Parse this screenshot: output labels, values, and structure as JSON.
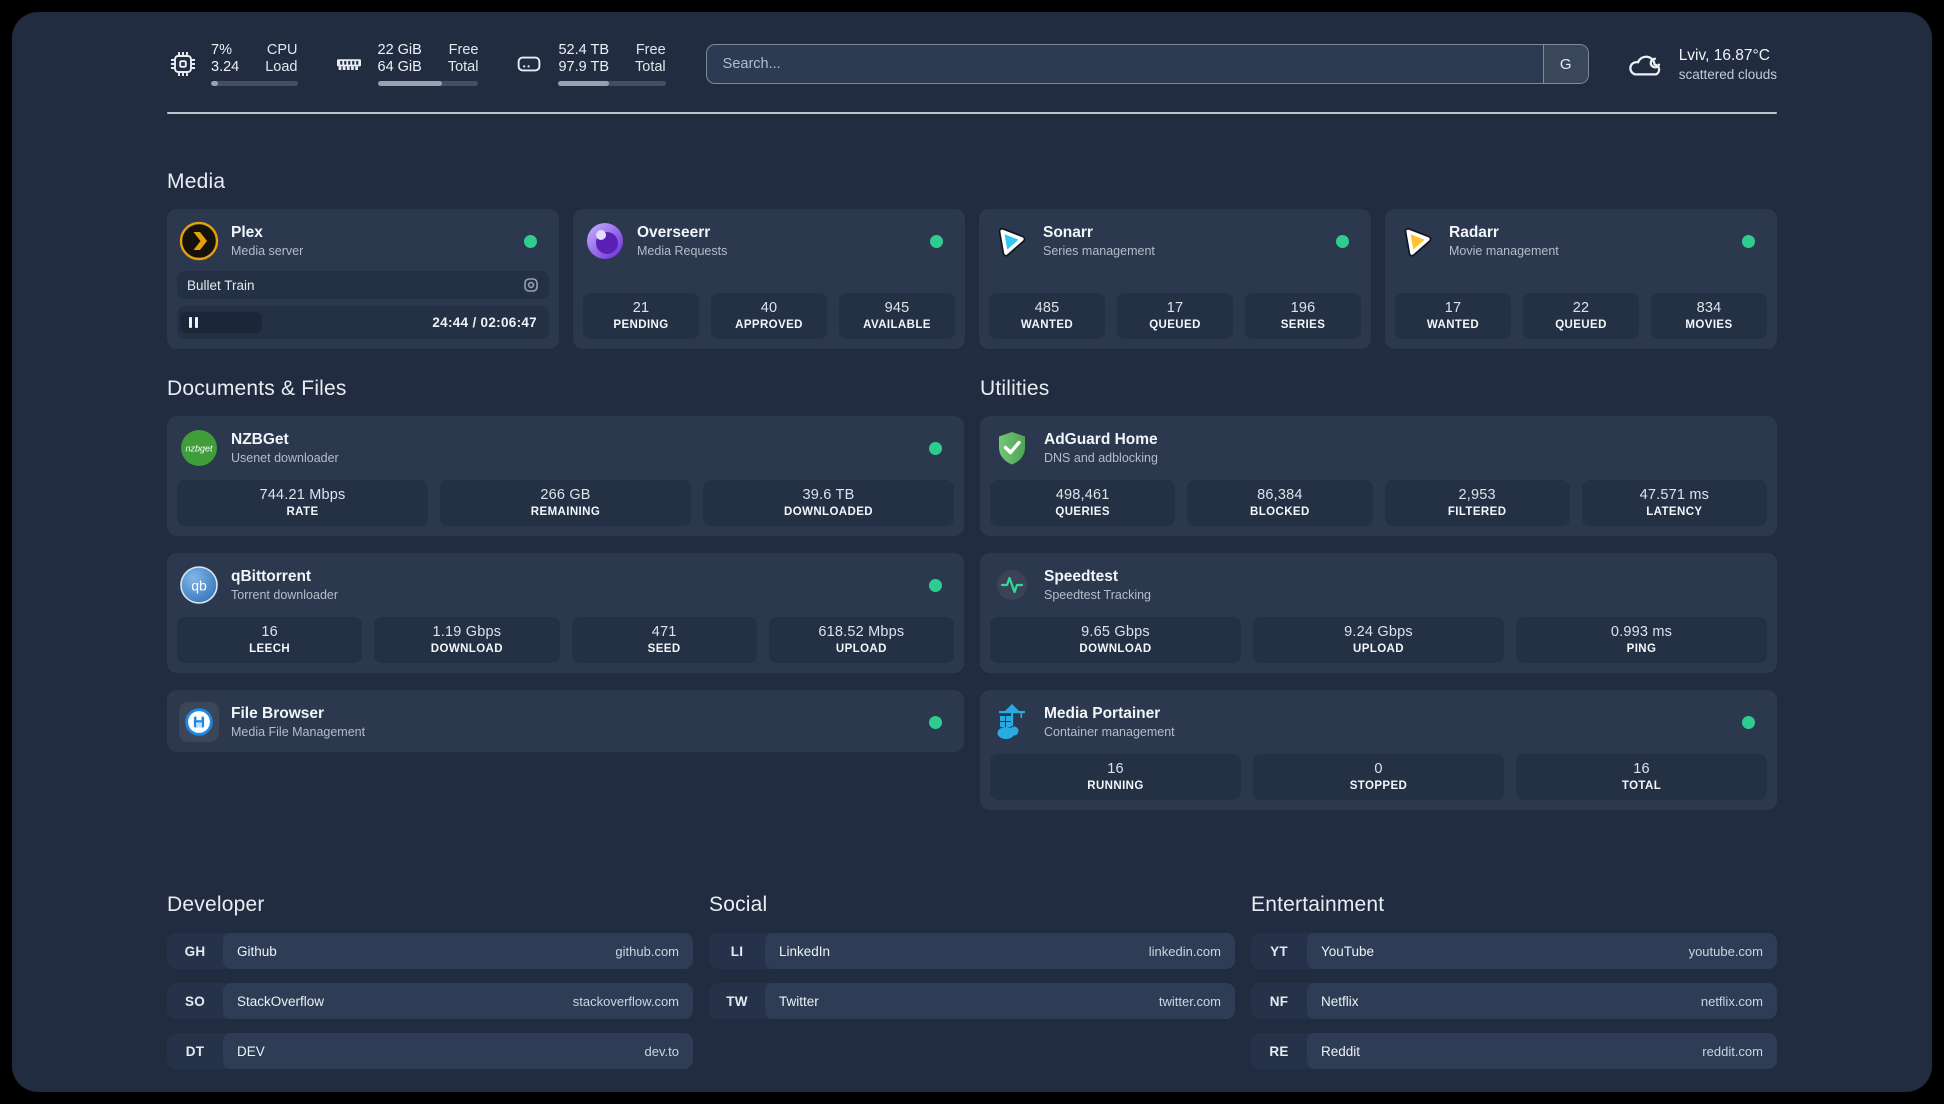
{
  "header": {
    "system": [
      {
        "icon": "cpu-icon",
        "values": [
          "7%",
          "3.24"
        ],
        "labels": [
          "CPU",
          "Load"
        ],
        "progress": 8
      },
      {
        "icon": "ram-icon",
        "values": [
          "22 GiB",
          "64 GiB"
        ],
        "labels": [
          "Free",
          "Total"
        ],
        "progress": 64
      },
      {
        "icon": "disk-icon",
        "values": [
          "52.4 TB",
          "97.9 TB"
        ],
        "labels": [
          "Free",
          "Total"
        ],
        "progress": 47
      }
    ],
    "search": {
      "placeholder": "Search...",
      "button_label": "G"
    },
    "weather": {
      "icon": "cloud-icon",
      "line1": "Lviv, 16.87°C",
      "line2": "scattered clouds"
    }
  },
  "media": {
    "title": "Media",
    "plex": {
      "icon": "plex-icon",
      "name": "Plex",
      "description": "Media server",
      "status": "online",
      "now_playing": "Bullet Train",
      "time": "24:44 / 02:06:47",
      "progress": 20
    },
    "overseerr": {
      "icon": "overseerr-icon",
      "name": "Overseerr",
      "description": "Media Requests",
      "status": "online",
      "stats": [
        {
          "value": "21",
          "label": "PENDING"
        },
        {
          "value": "40",
          "label": "APPROVED"
        },
        {
          "value": "945",
          "label": "AVAILABLE"
        }
      ]
    },
    "sonarr": {
      "icon": "sonarr-icon",
      "name": "Sonarr",
      "description": "Series management",
      "status": "online",
      "stats": [
        {
          "value": "485",
          "label": "WANTED"
        },
        {
          "value": "17",
          "label": "QUEUED"
        },
        {
          "value": "196",
          "label": "SERIES"
        }
      ]
    },
    "radarr": {
      "icon": "radarr-icon",
      "name": "Radarr",
      "description": "Movie management",
      "status": "online",
      "stats": [
        {
          "value": "17",
          "label": "WANTED"
        },
        {
          "value": "22",
          "label": "QUEUED"
        },
        {
          "value": "834",
          "label": "MOVIES"
        }
      ]
    }
  },
  "documents": {
    "title": "Documents & Files",
    "nzbget": {
      "icon": "nzbget-icon",
      "name": "NZBGet",
      "description": "Usenet downloader",
      "status": "online",
      "stats": [
        {
          "value": "744.21 Mbps",
          "label": "RATE"
        },
        {
          "value": "266 GB",
          "label": "REMAINING"
        },
        {
          "value": "39.6 TB",
          "label": "DOWNLOADED"
        }
      ]
    },
    "qbittorrent": {
      "icon": "qbittorrent-icon",
      "name": "qBittorrent",
      "description": "Torrent downloader",
      "status": "online",
      "stats": [
        {
          "value": "16",
          "label": "LEECH"
        },
        {
          "value": "1.19 Gbps",
          "label": "DOWNLOAD"
        },
        {
          "value": "471",
          "label": "SEED"
        },
        {
          "value": "618.52 Mbps",
          "label": "UPLOAD"
        }
      ]
    },
    "filebrowser": {
      "icon": "filebrowser-icon",
      "name": "File Browser",
      "description": "Media File Management",
      "status": "online"
    }
  },
  "utilities": {
    "title": "Utilities",
    "adguard": {
      "icon": "adguard-icon",
      "name": "AdGuard Home",
      "description": "DNS and adblocking",
      "stats": [
        {
          "value": "498,461",
          "label": "QUERIES"
        },
        {
          "value": "86,384",
          "label": "BLOCKED"
        },
        {
          "value": "2,953",
          "label": "FILTERED"
        },
        {
          "value": "47.571 ms",
          "label": "LATENCY"
        }
      ]
    },
    "speedtest": {
      "icon": "speedtest-icon",
      "name": "Speedtest",
      "description": "Speedtest Tracking",
      "stats": [
        {
          "value": "9.65 Gbps",
          "label": "DOWNLOAD"
        },
        {
          "value": "9.24 Gbps",
          "label": "UPLOAD"
        },
        {
          "value": "0.993 ms",
          "label": "PING"
        }
      ]
    },
    "portainer": {
      "icon": "portainer-icon",
      "name": "Media Portainer",
      "description": "Container management",
      "status": "online",
      "stats": [
        {
          "value": "16",
          "label": "RUNNING"
        },
        {
          "value": "0",
          "label": "STOPPED"
        },
        {
          "value": "16",
          "label": "TOTAL"
        }
      ]
    }
  },
  "links": {
    "developer": {
      "title": "Developer",
      "items": [
        {
          "abbr": "GH",
          "name": "Github",
          "url": "github.com"
        },
        {
          "abbr": "SO",
          "name": "StackOverflow",
          "url": "stackoverflow.com"
        },
        {
          "abbr": "DT",
          "name": "DEV",
          "url": "dev.to"
        }
      ]
    },
    "social": {
      "title": "Social",
      "items": [
        {
          "abbr": "LI",
          "name": "LinkedIn",
          "url": "linkedin.com"
        },
        {
          "abbr": "TW",
          "name": "Twitter",
          "url": "twitter.com"
        }
      ]
    },
    "entertainment": {
      "title": "Entertainment",
      "items": [
        {
          "abbr": "YT",
          "name": "YouTube",
          "url": "youtube.com"
        },
        {
          "abbr": "NF",
          "name": "Netflix",
          "url": "netflix.com"
        },
        {
          "abbr": "RE",
          "name": "Reddit",
          "url": "reddit.com"
        }
      ]
    }
  },
  "colors": {
    "status_online": "#2ecc8e",
    "plex_amber": "#e5a00d",
    "sonarr_blue": "#35c5f4",
    "radarr_gold": "#ffc230",
    "nzbget_green": "#3f9e3a",
    "qbittorrent_blue": "#4f9bd9",
    "filebrowser_blue": "#1e88e5",
    "adguard_green": "#5fbf62",
    "speedtest_green": "#2ddc9a",
    "portainer_blue": "#29abe2",
    "background": "#212c41",
    "card": "#2b384d",
    "tile": "#243044"
  }
}
